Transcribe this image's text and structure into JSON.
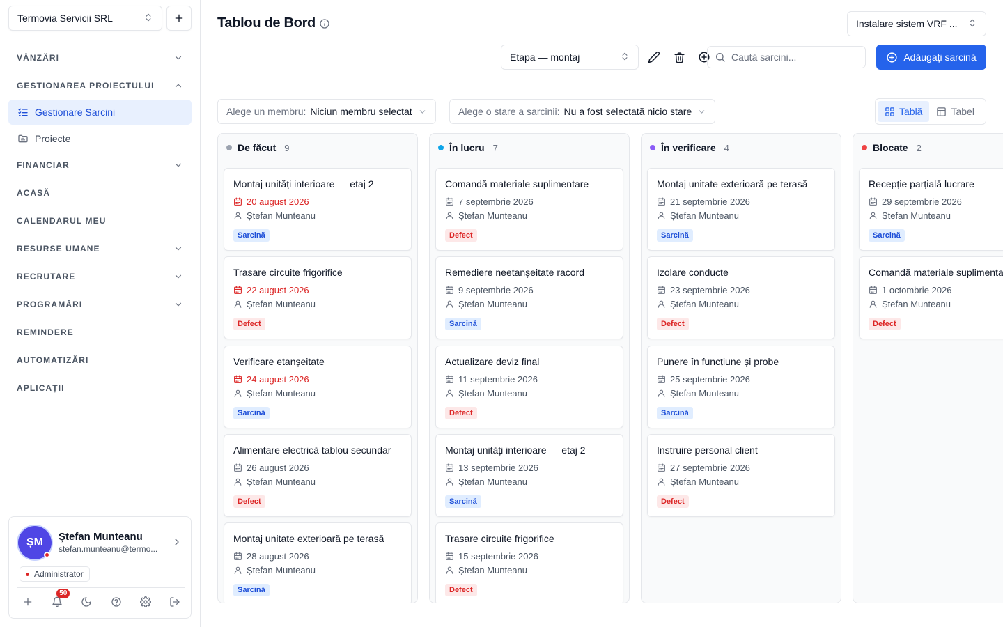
{
  "sidebar": {
    "company": "Termovia Servicii SRL",
    "nav": [
      {
        "type": "section",
        "label": "VÂNZĂRI",
        "chevron": "down"
      },
      {
        "type": "section",
        "label": "GESTIONAREA PROIECTULUI",
        "chevron": "up"
      },
      {
        "type": "item",
        "label": "Gestionare Sarcini",
        "icon": "list-check-icon",
        "active": true
      },
      {
        "type": "item",
        "label": "Proiecte",
        "icon": "folder-icon",
        "active": false
      },
      {
        "type": "section",
        "label": "FINANCIAR",
        "chevron": "down"
      },
      {
        "type": "section",
        "label": "ACASĂ",
        "chevron": ""
      },
      {
        "type": "section",
        "label": "CALENDARUL MEU",
        "chevron": ""
      },
      {
        "type": "section",
        "label": "RESURSE UMANE",
        "chevron": "down"
      },
      {
        "type": "section",
        "label": "RECRUTARE",
        "chevron": "down"
      },
      {
        "type": "section",
        "label": "PROGRAMĂRI",
        "chevron": "down"
      },
      {
        "type": "section",
        "label": "REMINDERE",
        "chevron": ""
      },
      {
        "type": "section",
        "label": "AUTOMATIZĂRI",
        "chevron": ""
      },
      {
        "type": "section",
        "label": "APLICAȚII",
        "chevron": ""
      }
    ],
    "user": {
      "initials": "ȘM",
      "name": "Ștefan Munteanu",
      "email": "stefan.munteanu@termo...",
      "role": "Administrator",
      "notifications": "50"
    }
  },
  "header": {
    "title": "Tablou de Bord",
    "project": "Instalare sistem VRF ...",
    "stage": "Etapa — montaj",
    "search_placeholder": "Caută sarcini...",
    "add_task": "Adăugați sarcină"
  },
  "filters": {
    "member_label": "Alege un membru:",
    "member_value": "Niciun membru selectat",
    "status_label": "Alege o stare a sarcinii:",
    "status_value": "Nu a fost selectată nicio stare",
    "view_board": "Tablă",
    "view_table": "Tabel"
  },
  "colors": {
    "accent": "#2563eb",
    "todo": "#9ca3af",
    "in_progress": "#0ea5e9",
    "review": "#8b5cf6",
    "blocked": "#ef4444"
  },
  "columns": [
    {
      "title": "De făcut",
      "count": "9",
      "color": "#9ca3af",
      "cards": [
        {
          "title": "Montaj unități interioare — etaj 2",
          "date": "20 august 2026",
          "overdue": true,
          "person": "Ștefan Munteanu",
          "tag": "Sarcină",
          "tag_type": "task"
        },
        {
          "title": "Trasare circuite frigorifice",
          "date": "22 august 2026",
          "overdue": true,
          "person": "Ștefan Munteanu",
          "tag": "Defect",
          "tag_type": "defect"
        },
        {
          "title": "Verificare etanșeitate",
          "date": "24 august 2026",
          "overdue": true,
          "person": "Ștefan Munteanu",
          "tag": "Sarcină",
          "tag_type": "task"
        },
        {
          "title": "Alimentare electrică tablou secundar",
          "date": "26 august 2026",
          "overdue": false,
          "person": "Ștefan Munteanu",
          "tag": "Defect",
          "tag_type": "defect"
        },
        {
          "title": "Montaj unitate exterioară pe terasă",
          "date": "28 august 2026",
          "overdue": false,
          "person": "Ștefan Munteanu",
          "tag": "Sarcină",
          "tag_type": "task"
        }
      ]
    },
    {
      "title": "În lucru",
      "count": "7",
      "color": "#0ea5e9",
      "cards": [
        {
          "title": "Comandă materiale suplimentare",
          "date": "7 septembrie 2026",
          "overdue": false,
          "person": "Ștefan Munteanu",
          "tag": "Defect",
          "tag_type": "defect"
        },
        {
          "title": "Remediere neetanșeitate racord",
          "date": "9 septembrie 2026",
          "overdue": false,
          "person": "Ștefan Munteanu",
          "tag": "Sarcină",
          "tag_type": "task"
        },
        {
          "title": "Actualizare deviz final",
          "date": "11 septembrie 2026",
          "overdue": false,
          "person": "Ștefan Munteanu",
          "tag": "Defect",
          "tag_type": "defect"
        },
        {
          "title": "Montaj unități interioare — etaj 2",
          "date": "13 septembrie 2026",
          "overdue": false,
          "person": "Ștefan Munteanu",
          "tag": "Sarcină",
          "tag_type": "task"
        },
        {
          "title": "Trasare circuite frigorifice",
          "date": "15 septembrie 2026",
          "overdue": false,
          "person": "Ștefan Munteanu",
          "tag": "Defect",
          "tag_type": "defect"
        }
      ]
    },
    {
      "title": "În verificare",
      "count": "4",
      "color": "#8b5cf6",
      "cards": [
        {
          "title": "Montaj unitate exterioară pe terasă",
          "date": "21 septembrie 2026",
          "overdue": false,
          "person": "Ștefan Munteanu",
          "tag": "Sarcină",
          "tag_type": "task"
        },
        {
          "title": "Izolare conducte",
          "date": "23 septembrie 2026",
          "overdue": false,
          "person": "Ștefan Munteanu",
          "tag": "Defect",
          "tag_type": "defect"
        },
        {
          "title": "Punere în funcțiune și probe",
          "date": "25 septembrie 2026",
          "overdue": false,
          "person": "Ștefan Munteanu",
          "tag": "Sarcină",
          "tag_type": "task"
        },
        {
          "title": "Instruire personal client",
          "date": "27 septembrie 2026",
          "overdue": false,
          "person": "Ștefan Munteanu",
          "tag": "Defect",
          "tag_type": "defect"
        }
      ]
    },
    {
      "title": "Blocate",
      "count": "2",
      "color": "#ef4444",
      "cards": [
        {
          "title": "Recepție parțială lucrare",
          "date": "29 septembrie 2026",
          "overdue": false,
          "person": "Ștefan Munteanu",
          "tag": "Sarcină",
          "tag_type": "task"
        },
        {
          "title": "Comandă materiale suplimentare",
          "date": "1 octombrie 2026",
          "overdue": false,
          "person": "Ștefan Munteanu",
          "tag": "Defect",
          "tag_type": "defect"
        }
      ]
    }
  ]
}
